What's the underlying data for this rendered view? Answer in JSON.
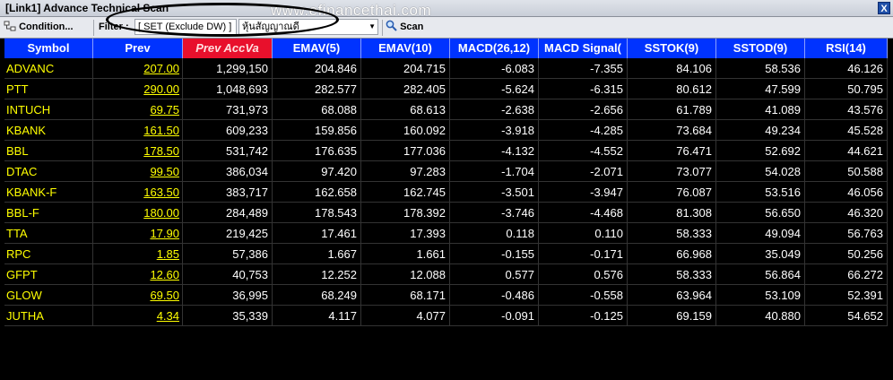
{
  "window": {
    "title": "[Link1] Advance Technical Scan",
    "close_label": "X"
  },
  "watermark": "www.efinancethai.com",
  "toolbar": {
    "condition_label": "Condition...",
    "filter_label": "Filter :",
    "filter_value": "[ SET (Exclude DW) ]",
    "category_value": "หุ้นสัญญาณดี",
    "scan_label": "Scan"
  },
  "columns": [
    "Symbol",
    "Prev",
    "Prev AccVa",
    "EMAV(5)",
    "EMAV(10)",
    "MACD(26,12)",
    "MACD Signal(",
    "SSTOK(9)",
    "SSTOD(9)",
    "RSI(14)"
  ],
  "rows": [
    [
      "ADVANC",
      "207.00",
      "1,299,150",
      "204.846",
      "204.715",
      "-6.083",
      "-7.355",
      "84.106",
      "58.536",
      "46.126"
    ],
    [
      "PTT",
      "290.00",
      "1,048,693",
      "282.577",
      "282.405",
      "-5.624",
      "-6.315",
      "80.612",
      "47.599",
      "50.795"
    ],
    [
      "INTUCH",
      "69.75",
      "731,973",
      "68.088",
      "68.613",
      "-2.638",
      "-2.656",
      "61.789",
      "41.089",
      "43.576"
    ],
    [
      "KBANK",
      "161.50",
      "609,233",
      "159.856",
      "160.092",
      "-3.918",
      "-4.285",
      "73.684",
      "49.234",
      "45.528"
    ],
    [
      "BBL",
      "178.50",
      "531,742",
      "176.635",
      "177.036",
      "-4.132",
      "-4.552",
      "76.471",
      "52.692",
      "44.621"
    ],
    [
      "DTAC",
      "99.50",
      "386,034",
      "97.420",
      "97.283",
      "-1.704",
      "-2.071",
      "73.077",
      "54.028",
      "50.588"
    ],
    [
      "KBANK-F",
      "163.50",
      "383,717",
      "162.658",
      "162.745",
      "-3.501",
      "-3.947",
      "76.087",
      "53.516",
      "46.056"
    ],
    [
      "BBL-F",
      "180.00",
      "284,489",
      "178.543",
      "178.392",
      "-3.746",
      "-4.468",
      "81.308",
      "56.650",
      "46.320"
    ],
    [
      "TTA",
      "17.90",
      "219,425",
      "17.461",
      "17.393",
      "0.118",
      "0.110",
      "58.333",
      "49.094",
      "56.763"
    ],
    [
      "RPC",
      "1.85",
      "57,386",
      "1.667",
      "1.661",
      "-0.155",
      "-0.171",
      "66.968",
      "35.049",
      "50.256"
    ],
    [
      "GFPT",
      "12.60",
      "40,753",
      "12.252",
      "12.088",
      "0.577",
      "0.576",
      "58.333",
      "56.864",
      "66.272"
    ],
    [
      "GLOW",
      "69.50",
      "36,995",
      "68.249",
      "68.171",
      "-0.486",
      "-0.558",
      "63.964",
      "53.109",
      "52.391"
    ],
    [
      "JUTHA",
      "4.34",
      "35,339",
      "4.117",
      "4.077",
      "-0.091",
      "-0.125",
      "69.159",
      "40.880",
      "54.652"
    ]
  ]
}
